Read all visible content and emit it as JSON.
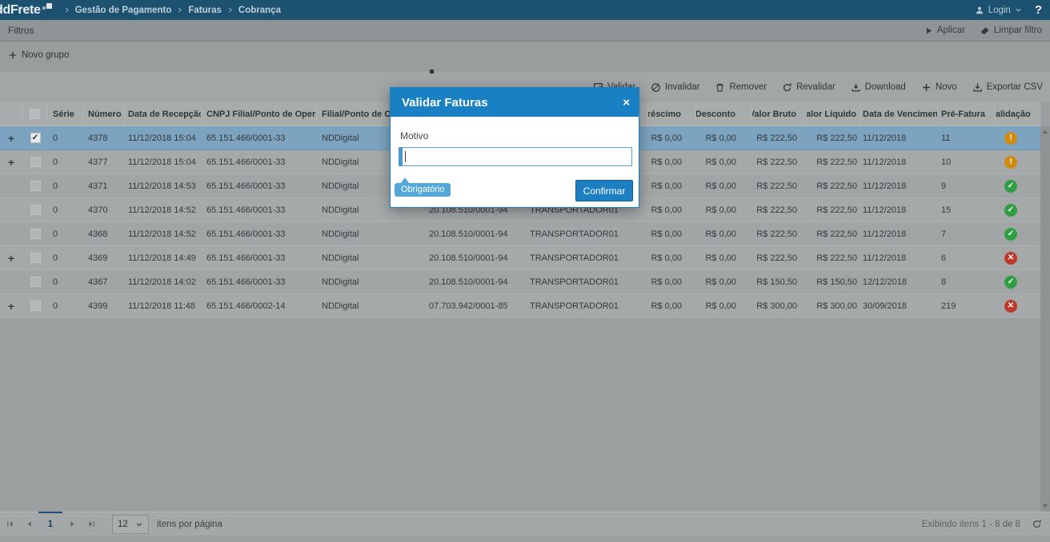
{
  "topnav": {
    "logo": "ddFrete",
    "breadcrumb": [
      {
        "label": "Gestão de Pagamento"
      },
      {
        "label": "Faturas"
      },
      {
        "label": "Cobrança"
      }
    ],
    "login": "Login",
    "help": "?"
  },
  "filters": {
    "title": "Filtros",
    "apply": "Aplicar",
    "clear": "Limpar filtro",
    "new_group": "Novo grupo"
  },
  "toolbar": {
    "buttons": [
      {
        "icon": "check-square",
        "label": "Validar"
      },
      {
        "icon": "slash-circle",
        "label": "Invalidar"
      },
      {
        "icon": "trash",
        "label": "Remover"
      },
      {
        "icon": "refresh",
        "label": "Revalidar"
      },
      {
        "icon": "download",
        "label": "Download"
      },
      {
        "icon": "plus",
        "label": "Novo"
      },
      {
        "icon": "export",
        "label": "Exportar CSV"
      }
    ]
  },
  "table": {
    "columns": [
      {
        "label": ""
      },
      {
        "label": ""
      },
      {
        "label": "Série"
      },
      {
        "label": "Número"
      },
      {
        "label": "Data de Recepção",
        "sort": "desc"
      },
      {
        "label": "CNPJ Filial/Ponto de Operação"
      },
      {
        "label": "Filial/Ponto de Operação"
      },
      {
        "label": ""
      },
      {
        "label": ""
      },
      {
        "label": "Acréscimo"
      },
      {
        "label": "Desconto"
      },
      {
        "label": "Valor Bruto"
      },
      {
        "label": "Valor Líquido"
      },
      {
        "label": "Data de Vencimento"
      },
      {
        "label": "Pré-Fatura"
      },
      {
        "label": "Validação"
      }
    ],
    "rows": [
      {
        "expand": true,
        "checked": true,
        "selected": true,
        "serie": "0",
        "numero": "4378",
        "recepcao": "11/12/2018 15:04",
        "cnpj_filial": "65.151.466/0001-33",
        "filial": "NDDigital",
        "cnpj_transportador": "",
        "transportador": "",
        "acrescimo": "R$ 0,00",
        "desconto": "R$ 0,00",
        "valor_bruto": "R$ 222,50",
        "valor_liquido": "R$ 222,50",
        "vencimento": "11/12/2018",
        "pre_fatura": "11",
        "validacao": "warning"
      },
      {
        "expand": true,
        "checked": false,
        "selected": false,
        "serie": "0",
        "numero": "4377",
        "recepcao": "11/12/2018 15:04",
        "cnpj_filial": "65.151.466/0001-33",
        "filial": "NDDigital",
        "cnpj_transportador": "",
        "transportador": "",
        "acrescimo": "R$ 0,00",
        "desconto": "R$ 0,00",
        "valor_bruto": "R$ 222,50",
        "valor_liquido": "R$ 222,50",
        "vencimento": "11/12/2018",
        "pre_fatura": "10",
        "validacao": "warning"
      },
      {
        "expand": false,
        "checked": false,
        "selected": false,
        "serie": "0",
        "numero": "4371",
        "recepcao": "11/12/2018 14:53",
        "cnpj_filial": "65.151.466/0001-33",
        "filial": "NDDigital",
        "cnpj_transportador": "",
        "transportador": "",
        "acrescimo": "R$ 0,00",
        "desconto": "R$ 0,00",
        "valor_bruto": "R$ 222,50",
        "valor_liquido": "R$ 222,50",
        "vencimento": "11/12/2018",
        "pre_fatura": "9",
        "validacao": "success"
      },
      {
        "expand": false,
        "checked": false,
        "selected": false,
        "serie": "0",
        "numero": "4370",
        "recepcao": "11/12/2018 14:52",
        "cnpj_filial": "65.151.466/0001-33",
        "filial": "NDDigital",
        "cnpj_transportador": "20.108.510/0001-94",
        "transportador": "TRANSPORTADOR01",
        "acrescimo": "R$ 0,00",
        "desconto": "R$ 0,00",
        "valor_bruto": "R$ 222,50",
        "valor_liquido": "R$ 222,50",
        "vencimento": "11/12/2018",
        "pre_fatura": "15",
        "validacao": "success"
      },
      {
        "expand": false,
        "checked": false,
        "selected": false,
        "serie": "0",
        "numero": "4368",
        "recepcao": "11/12/2018 14:52",
        "cnpj_filial": "65.151.466/0001-33",
        "filial": "NDDigital",
        "cnpj_transportador": "20.108.510/0001-94",
        "transportador": "TRANSPORTADOR01",
        "acrescimo": "R$ 0,00",
        "desconto": "R$ 0,00",
        "valor_bruto": "R$ 222,50",
        "valor_liquido": "R$ 222,50",
        "vencimento": "11/12/2018",
        "pre_fatura": "7",
        "validacao": "success"
      },
      {
        "expand": true,
        "checked": false,
        "selected": false,
        "serie": "0",
        "numero": "4369",
        "recepcao": "11/12/2018 14:49",
        "cnpj_filial": "65.151.466/0001-33",
        "filial": "NDDigital",
        "cnpj_transportador": "20.108.510/0001-94",
        "transportador": "TRANSPORTADOR01",
        "acrescimo": "R$ 0,00",
        "desconto": "R$ 0,00",
        "valor_bruto": "R$ 222,50",
        "valor_liquido": "R$ 222,50",
        "vencimento": "11/12/2018",
        "pre_fatura": "6",
        "validacao": "error"
      },
      {
        "expand": false,
        "checked": false,
        "selected": false,
        "serie": "0",
        "numero": "4367",
        "recepcao": "11/12/2018 14:02",
        "cnpj_filial": "65.151.466/0001-33",
        "filial": "NDDigital",
        "cnpj_transportador": "20.108.510/0001-94",
        "transportador": "TRANSPORTADOR01",
        "acrescimo": "R$ 0,00",
        "desconto": "R$ 0,00",
        "valor_bruto": "R$ 150,50",
        "valor_liquido": "R$ 150,50",
        "vencimento": "12/12/2018",
        "pre_fatura": "8",
        "validacao": "success"
      },
      {
        "expand": true,
        "checked": false,
        "selected": false,
        "serie": "0",
        "numero": "4399",
        "recepcao": "11/12/2018 11:48",
        "cnpj_filial": "65.151.466/0002-14",
        "filial": "NDDigital",
        "cnpj_transportador": "07.703.942/0001-85",
        "transportador": "TRANSPORTADOR01",
        "acrescimo": "R$ 0,00",
        "desconto": "R$ 0,00",
        "valor_bruto": "R$ 300,00",
        "valor_liquido": "R$ 300,00",
        "vencimento": "30/09/2018",
        "pre_fatura": "219",
        "validacao": "error"
      }
    ]
  },
  "pager": {
    "page": "1",
    "page_size": "12",
    "items_label": "itens por página",
    "status": "Exibindo itens 1 - 8 de 8"
  },
  "modal": {
    "title": "Validar Faturas",
    "close": "×",
    "field_label": "Motivo",
    "input_value": "",
    "tooltip": "Obrigatório",
    "confirm": "Confirmar"
  },
  "colors": {
    "topnav": "#1d5170",
    "modal_accent": "#1a80c4",
    "confirm_button": "#1b7fc2",
    "selected_row": "#7ca3bf",
    "status_warning": "#cf8c10",
    "status_success": "#2f9e43",
    "status_error": "#bf392d"
  }
}
